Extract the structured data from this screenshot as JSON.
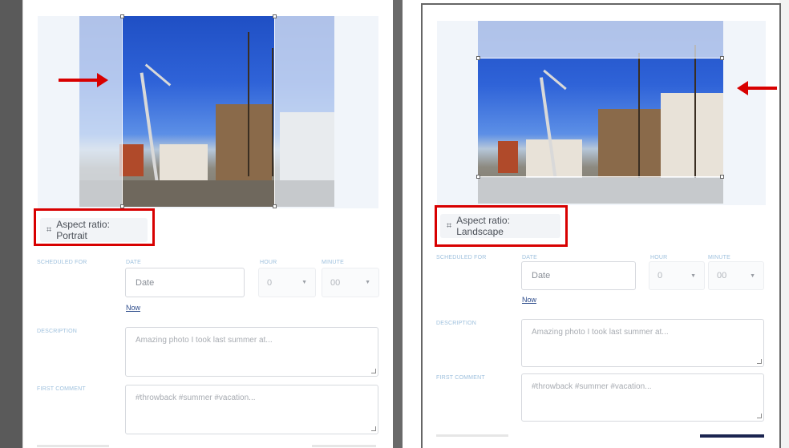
{
  "colors": {
    "accent_red": "#d80000",
    "link_blue": "#2b4a8a",
    "label_blue": "#9fc1de"
  },
  "left_panel": {
    "aspect_ratio_button": {
      "icon": "crop-icon",
      "label": "Aspect ratio: Portrait"
    },
    "scheduled_for_label": "SCHEDULED FOR",
    "date_label": "DATE",
    "date_placeholder": "Date",
    "hour_label": "HOUR",
    "hour_value": "0",
    "minute_label": "MINUTE",
    "minute_value": "00",
    "now_link": "Now",
    "description_label": "DESCRIPTION",
    "description_placeholder": "Amazing photo I took last summer at...",
    "first_comment_label": "FIRST COMMENT",
    "first_comment_placeholder": "#throwback #summer #vacation..."
  },
  "right_panel": {
    "aspect_ratio_button": {
      "icon": "crop-icon",
      "label": "Aspect ratio: Landscape"
    },
    "scheduled_for_label": "SCHEDULED FOR",
    "date_label": "DATE",
    "date_placeholder": "Date",
    "hour_label": "HOUR",
    "hour_value": "0",
    "minute_label": "MINUTE",
    "minute_value": "00",
    "now_link": "Now",
    "description_label": "DESCRIPTION",
    "description_placeholder": "Amazing photo I took last summer at...",
    "first_comment_label": "FIRST COMMENT",
    "first_comment_placeholder": "#throwback #summer #vacation..."
  }
}
